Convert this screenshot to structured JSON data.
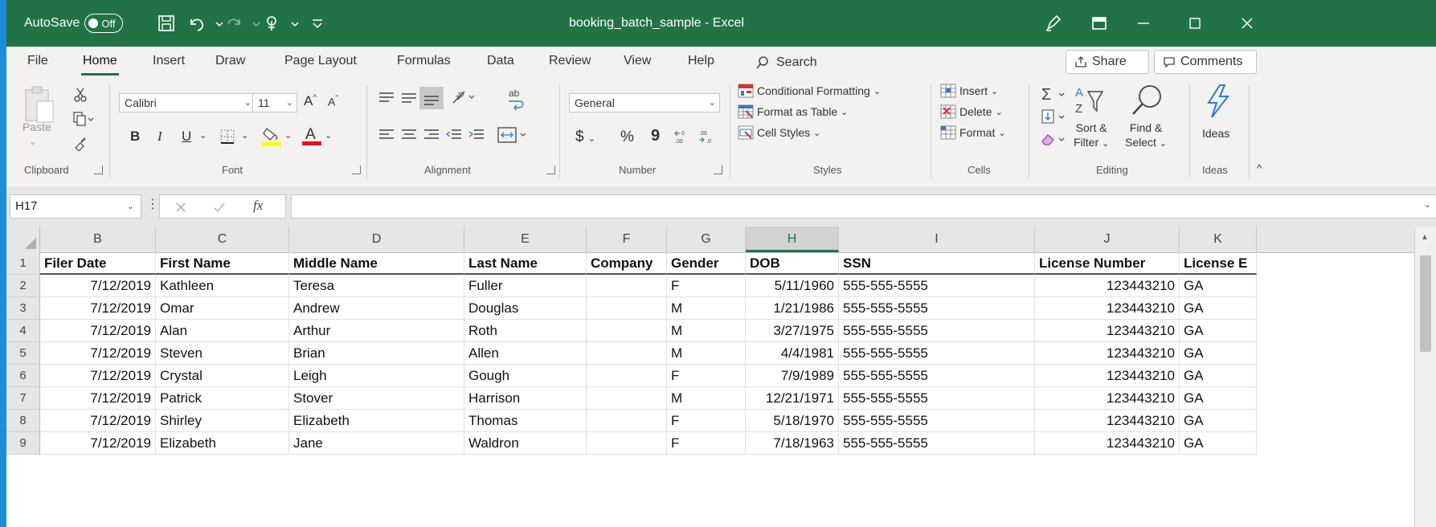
{
  "window": {
    "title": "booking_batch_sample - Excel",
    "autosave_label": "AutoSave",
    "autosave_state": "Off"
  },
  "tabs": [
    "File",
    "Home",
    "Insert",
    "Draw",
    "Page Layout",
    "Formulas",
    "Data",
    "Review",
    "View",
    "Help"
  ],
  "active_tab": "Home",
  "search_label": "Search",
  "share_label": "Share",
  "comments_label": "Comments",
  "ribbon": {
    "clipboard": {
      "paste": "Paste",
      "label": "Clipboard"
    },
    "font": {
      "name": "Calibri",
      "size": "11",
      "label": "Font",
      "bold": "B",
      "italic": "I",
      "underline": "U",
      "grow": "A",
      "shrink": "A",
      "fill_letter": "A"
    },
    "alignment": {
      "label": "Alignment",
      "wrap": "ab"
    },
    "number": {
      "format": "General",
      "currency": "$",
      "percent": "%",
      "comma": "9",
      "label": "Number"
    },
    "styles": {
      "conditional": "Conditional Formatting",
      "format_table": "Format as Table",
      "cell_styles": "Cell Styles",
      "label": "Styles"
    },
    "cells": {
      "insert": "Insert",
      "delete": "Delete",
      "format": "Format",
      "label": "Cells"
    },
    "editing": {
      "sort_filter_1": "Sort &",
      "sort_filter_2": "Filter",
      "find_select_1": "Find &",
      "find_select_2": "Select",
      "label": "Editing"
    },
    "ideas": {
      "button": "Ideas",
      "label": "Ideas"
    }
  },
  "formula_bar": {
    "name_box": "H17",
    "fx": "fx",
    "value": ""
  },
  "grid": {
    "columns": [
      "B",
      "C",
      "D",
      "E",
      "F",
      "G",
      "H",
      "I",
      "J",
      "K"
    ],
    "selected_column": "H",
    "row_numbers": [
      "1",
      "2",
      "3",
      "4",
      "5",
      "6",
      "7",
      "8",
      "9"
    ],
    "headers": [
      "Filer Date",
      "First Name",
      "Middle Name",
      "Last Name",
      "Company",
      "Gender",
      "DOB",
      "SSN",
      "License Number",
      "License E"
    ],
    "rows": [
      [
        "7/12/2019",
        "Kathleen",
        "Teresa",
        "Fuller",
        "",
        "F",
        "5/11/1960",
        "555-555-5555",
        "123443210",
        "GA"
      ],
      [
        "7/12/2019",
        "Omar",
        "Andrew",
        "Douglas",
        "",
        "M",
        "1/21/1986",
        "555-555-5555",
        "123443210",
        "GA"
      ],
      [
        "7/12/2019",
        "Alan",
        "Arthur",
        "Roth",
        "",
        "M",
        "3/27/1975",
        "555-555-5555",
        "123443210",
        "GA"
      ],
      [
        "7/12/2019",
        "Steven",
        "Brian",
        "Allen",
        "",
        "M",
        "4/4/1981",
        "555-555-5555",
        "123443210",
        "GA"
      ],
      [
        "7/12/2019",
        "Crystal",
        "Leigh",
        "Gough",
        "",
        "F",
        "7/9/1989",
        "555-555-5555",
        "123443210",
        "GA"
      ],
      [
        "7/12/2019",
        "Patrick",
        "Stover",
        "Harrison",
        "",
        "M",
        "12/21/1971",
        "555-555-5555",
        "123443210",
        "GA"
      ],
      [
        "7/12/2019",
        "Shirley",
        "Elizabeth",
        "Thomas",
        "",
        "F",
        "5/18/1970",
        "555-555-5555",
        "123443210",
        "GA"
      ],
      [
        "7/12/2019",
        "Elizabeth",
        "Jane",
        "Waldron",
        "",
        "F",
        "7/18/1963",
        "555-555-5555",
        "123443210",
        "GA"
      ]
    ]
  },
  "colors": {
    "excel_green": "#217346",
    "background_blue": "#1a8ddb"
  }
}
